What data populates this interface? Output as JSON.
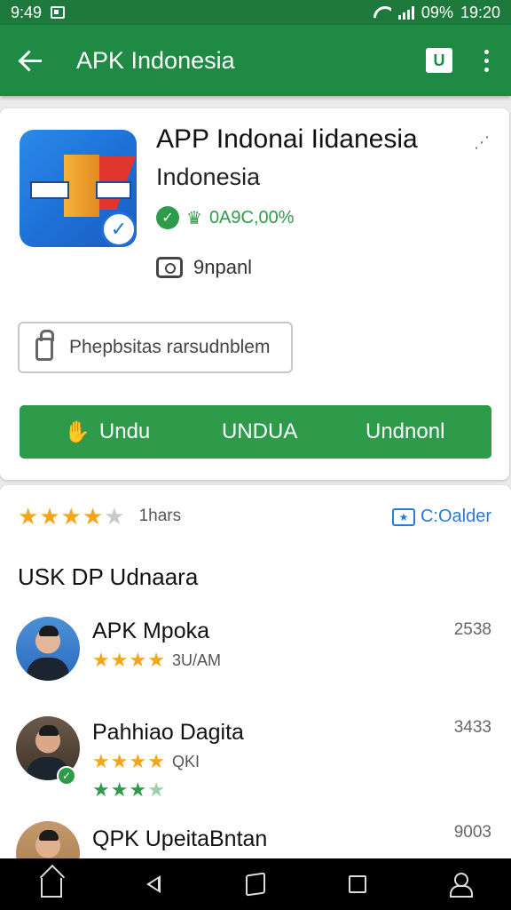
{
  "status_bar": {
    "time_left": "9:49",
    "battery": "09%",
    "time_right": "19:20"
  },
  "app_bar": {
    "title": "APK Indonesia",
    "shield_glyph": "U"
  },
  "app": {
    "name": "APP Indonai Iidanesia",
    "developer": "Indonesia",
    "badge_text": "0A9C,00%",
    "camera_text": "9npanl",
    "permission_text": "Phepbsitas rarsudnblem",
    "icon_colors": {
      "primary": "#1e6fd6",
      "accent": "#e0362c",
      "building": "#f5b23a"
    }
  },
  "download": {
    "btn1": "Undu",
    "btn2": "UNDUA",
    "btn3": "Undnonl",
    "color": "#2e9b4a"
  },
  "rating": {
    "stars": 4.5,
    "count_text": "1hars",
    "collect_label": "C:Oalder"
  },
  "section": {
    "title": "USK DP Udnaara"
  },
  "list": [
    {
      "name": "APK Mpoka",
      "stars": 3.5,
      "sub": "3U/AM",
      "count": "2538"
    },
    {
      "name": "Pahhiao Dagita",
      "stars": 4,
      "sub": "QKI",
      "count": "3433",
      "green_stars": 3.5
    },
    {
      "name": "QPK UpeitaBntan",
      "count": "9003"
    }
  ],
  "colors": {
    "status_bar": "#1e7a3c",
    "app_bar": "#1f8a44",
    "star": "#f4a51c",
    "link": "#2a79d8"
  }
}
